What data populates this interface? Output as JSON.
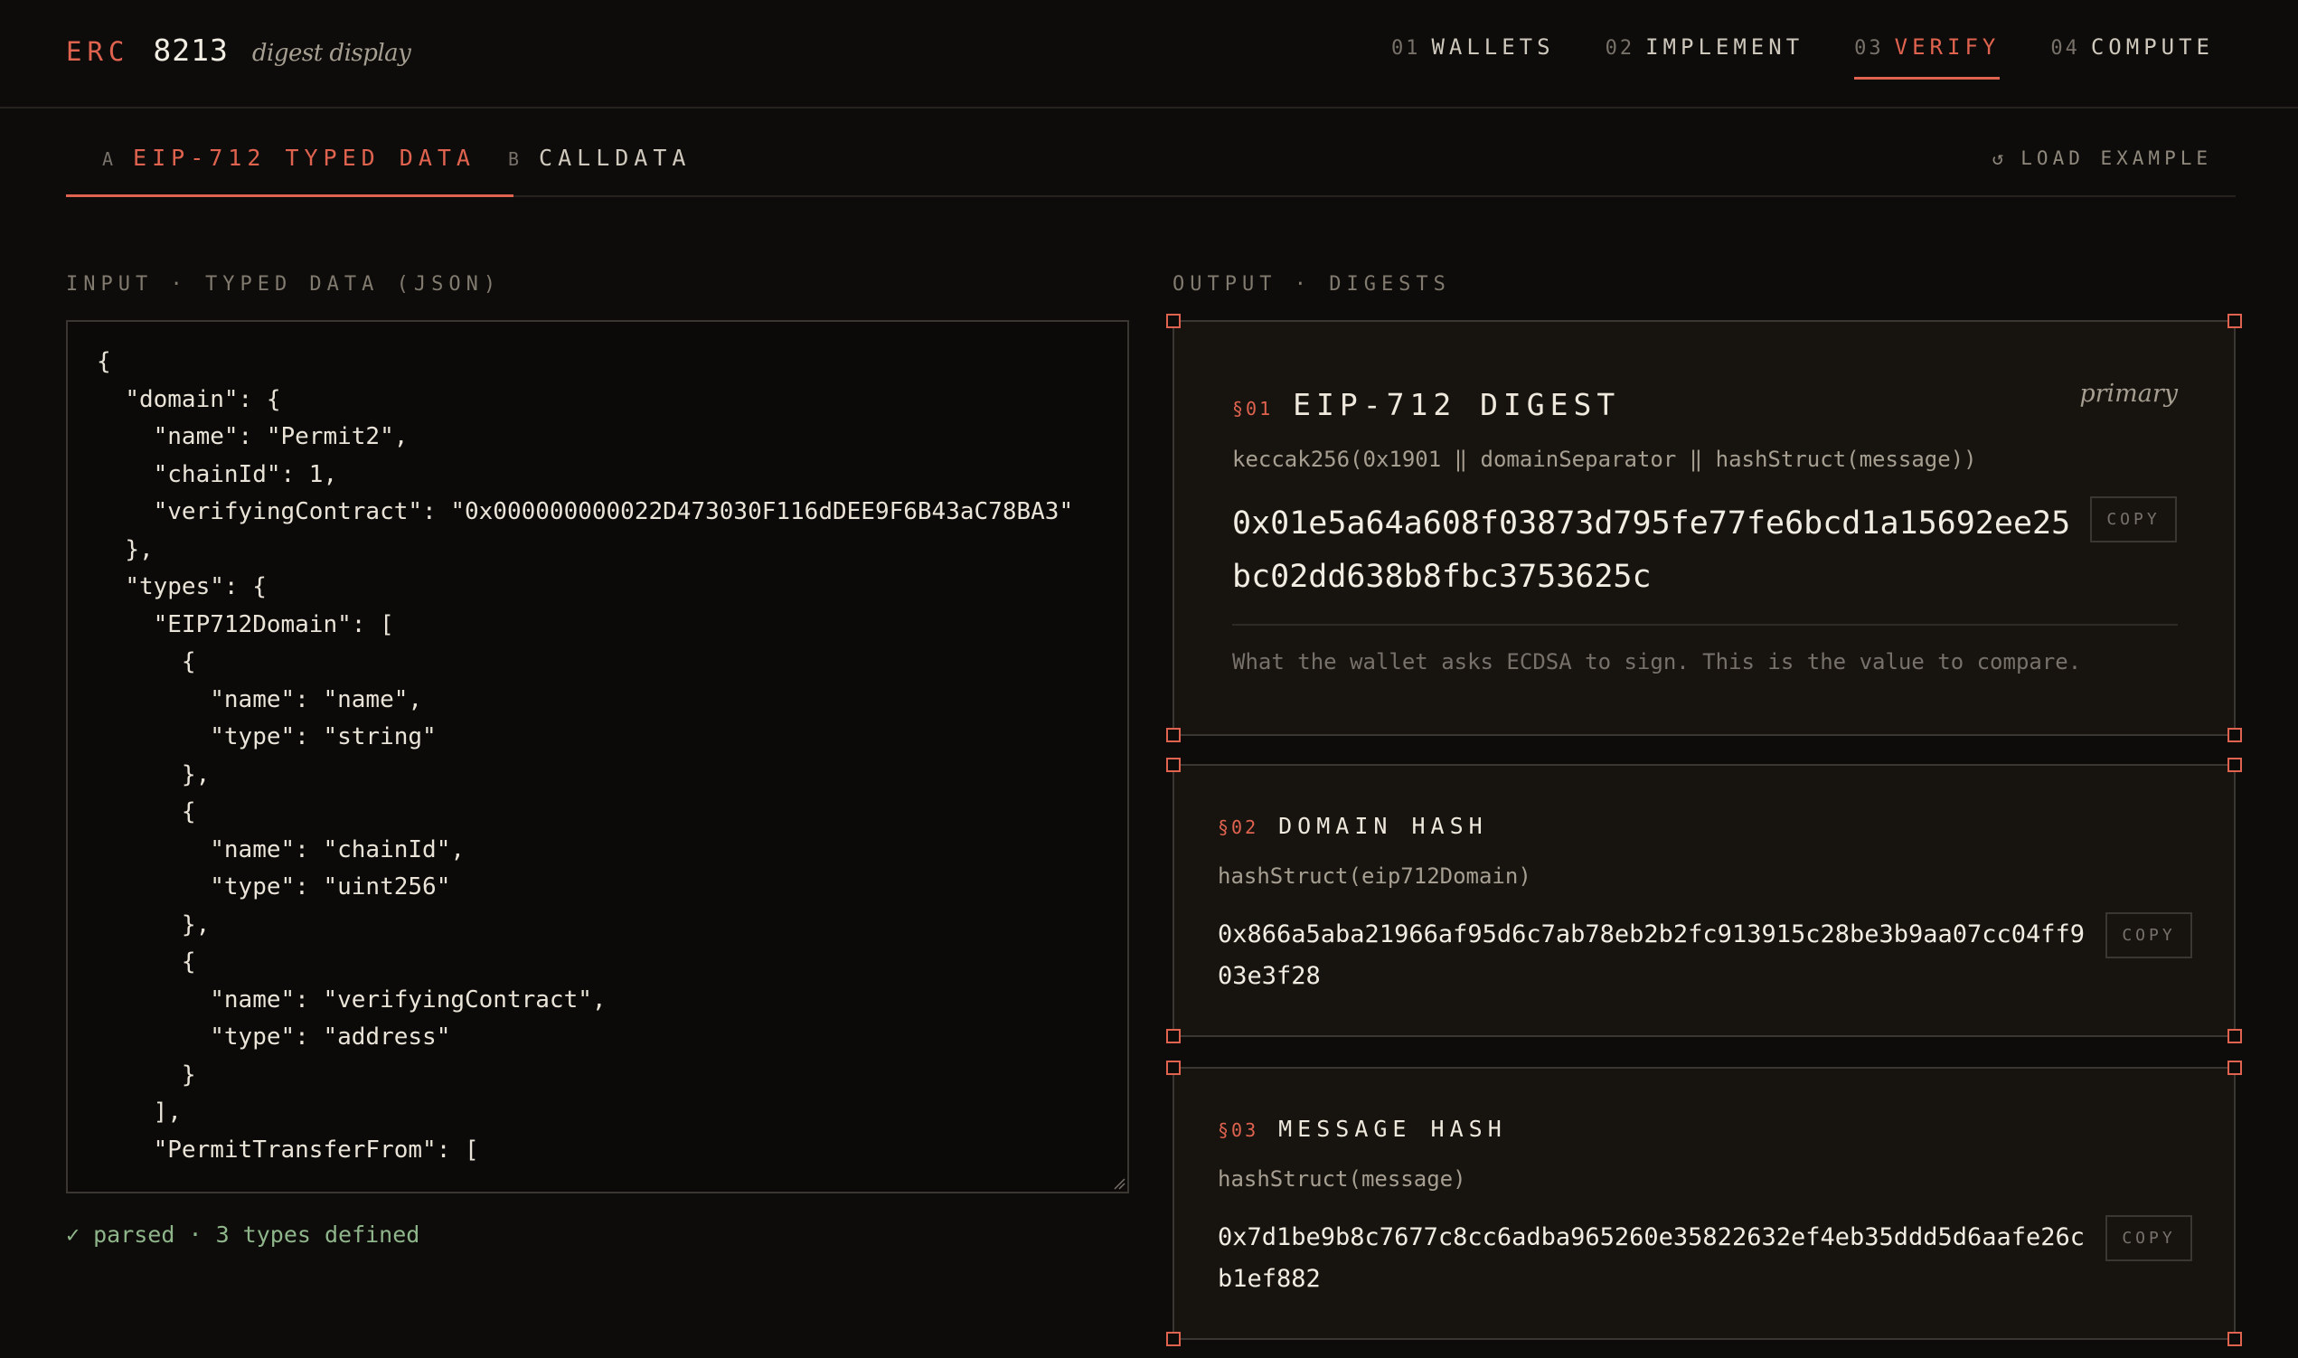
{
  "brand": {
    "erc": "ERC",
    "number": "8213",
    "subtitle": "digest display"
  },
  "nav": [
    {
      "num": "01",
      "label": "WALLETS",
      "active": false
    },
    {
      "num": "02",
      "label": "IMPLEMENT",
      "active": false
    },
    {
      "num": "03",
      "label": "VERIFY",
      "active": true
    },
    {
      "num": "04",
      "label": "COMPUTE",
      "active": false
    }
  ],
  "tabs": [
    {
      "letter": "A",
      "label": "EIP-712 TYPED DATA",
      "active": true
    },
    {
      "letter": "B",
      "label": "CALLDATA",
      "active": false
    }
  ],
  "load_example": {
    "icon": "↺",
    "label": "LOAD EXAMPLE"
  },
  "input": {
    "label": "INPUT · TYPED DATA (JSON)",
    "json_text": "{\n  \"domain\": {\n    \"name\": \"Permit2\",\n    \"chainId\": 1,\n    \"verifyingContract\": \"0x000000000022D473030F116dDEE9F6B43aC78BA3\"\n  },\n  \"types\": {\n    \"EIP712Domain\": [\n      {\n        \"name\": \"name\",\n        \"type\": \"string\"\n      },\n      {\n        \"name\": \"chainId\",\n        \"type\": \"uint256\"\n      },\n      {\n        \"name\": \"verifyingContract\",\n        \"type\": \"address\"\n      }\n    ],\n    \"PermitTransferFrom\": [",
    "status": "✓ parsed · 3 types defined"
  },
  "output": {
    "label": "OUTPUT · DIGESTS",
    "cards": [
      {
        "num": "§01",
        "title": "EIP-712 DIGEST",
        "tag": "primary",
        "formula": "keccak256(0x1901 ‖ domainSeparator ‖ hashStruct(message))",
        "hash": "0x01e5a64a608f03873d795fe77fe6bcd1a15692ee25bc02dd638b8fbc3753625c",
        "copy": "COPY",
        "note": "What the wallet asks ECDSA to sign. This is the value to compare."
      },
      {
        "num": "§02",
        "title": "DOMAIN HASH",
        "formula": "hashStruct(eip712Domain)",
        "hash": "0x866a5aba21966af95d6c7ab78eb2b2fc913915c28be3b9aa07cc04ff903e3f28",
        "copy": "COPY"
      },
      {
        "num": "§03",
        "title": "MESSAGE HASH",
        "formula": "hashStruct(message)",
        "hash": "0x7d1be9b8c7677c8cc6adba965260e35822632ef4eb35ddd5d6aafe26cb1ef882",
        "copy": "COPY"
      }
    ]
  },
  "colors": {
    "accent": "#e0634f",
    "background": "#0d0c0a",
    "card": "#171410",
    "success": "#8fb58a"
  }
}
